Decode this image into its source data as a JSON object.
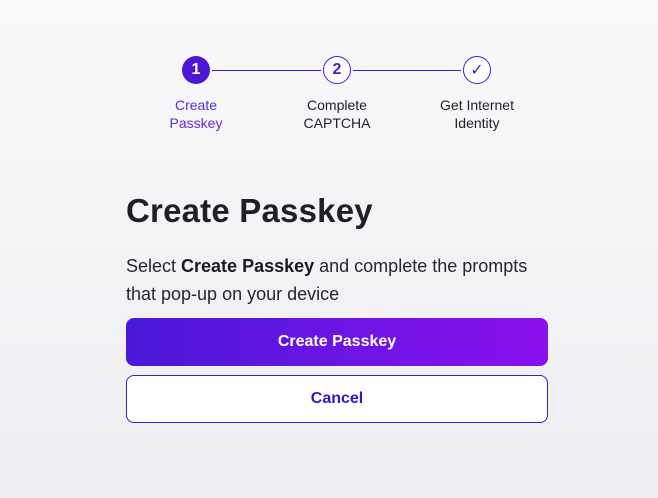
{
  "stepper": {
    "steps": [
      {
        "marker": "1",
        "label": "Create\nPasskey",
        "state": "active"
      },
      {
        "marker": "2",
        "label": "Complete\nCAPTCHA",
        "state": "pending"
      },
      {
        "marker": "✓",
        "label": "Get Internet\nIdentity",
        "state": "pending"
      }
    ]
  },
  "main": {
    "title": "Create Passkey",
    "instructions": {
      "prefix": "Select ",
      "bold": "Create Passkey",
      "suffix": " and complete the prompts that pop-up on your device"
    },
    "create_button_label": "Create Passkey",
    "cancel_button_label": "Cancel"
  },
  "colors": {
    "accent": "#4b17d6",
    "gradient_end": "#8a10ee",
    "text": "#1f1f24",
    "active_label": "#5b2ddf"
  }
}
